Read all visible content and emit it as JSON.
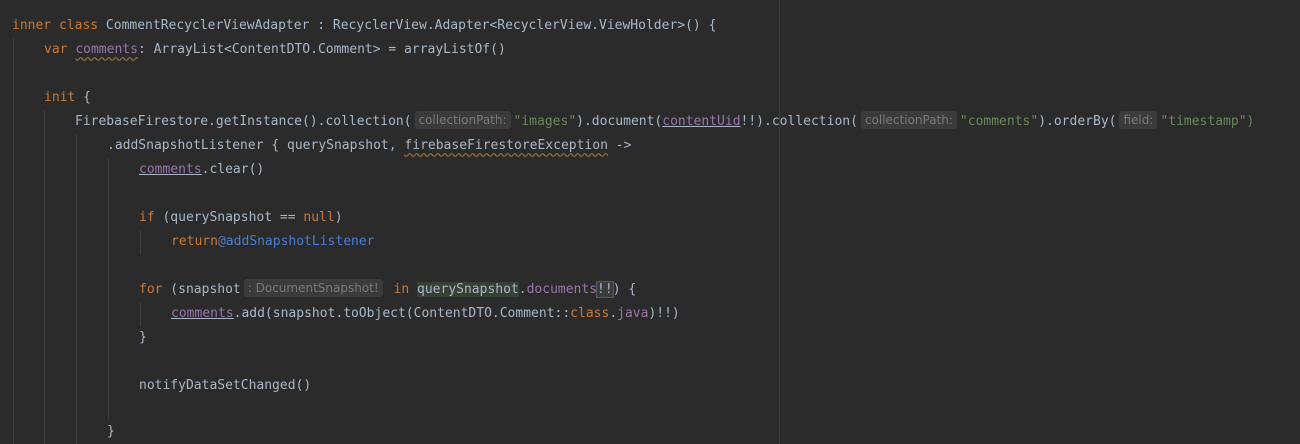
{
  "editor": {
    "language": "Kotlin",
    "lines": {
      "l1": {
        "t1": "inner class",
        "t2": " CommentRecyclerViewAdapter : RecyclerView.Adapter<RecyclerView.ViewHolder>() {"
      },
      "l2": {
        "t1": "var",
        "t2": "comments",
        "t3": ": ArrayList<ContentDTO.Comment> = arrayListOf()"
      },
      "l3": {
        "t1": "init",
        "t2": " {"
      },
      "l4": {
        "t1": "FirebaseFirestore.getInstance().collection(",
        "hint1": "collectionPath:",
        "s1": "\"images\"",
        "t2": ").document(",
        "ref1": "contentUid",
        "t3": "!!).collection(",
        "hint2": "collectionPath:",
        "s2": "\"comments\"",
        "t4": ").orderBy(",
        "hint3": "field:",
        "s3": "\"timestamp\")"
      },
      "l5": {
        "t1": ".addSnapshotListener { querySnapshot, ",
        "t2": "firebaseFirestoreException",
        "t3": " ->"
      },
      "l6": {
        "t1": "comments",
        "t2": ".clear()"
      },
      "l7": {
        "t1": "if",
        "t2": " (querySnapshot == ",
        "t3": "null",
        "t4": ")"
      },
      "l8": {
        "t1": "return",
        "t2": "@addSnapshotListener"
      },
      "l9": {
        "t1": "for",
        "t2": " (snapshot",
        "hint": ": DocumentSnapshot!",
        "t3": "in",
        "t4": "querySnapshot",
        "t5": ".",
        "t6": "documents",
        "t7": "!!",
        "t8": ") {"
      },
      "l10": {
        "t1": "comments",
        "t2": ".add(snapshot.toObject(ContentDTO.Comment::",
        "t3": "class",
        "t4": ".",
        "t5": "java",
        "t6": ")!!)"
      },
      "l11": {
        "t1": "}"
      },
      "l12": {
        "t1": "notifyDataSetChanged()"
      },
      "l13": {
        "t1": "}"
      }
    }
  }
}
